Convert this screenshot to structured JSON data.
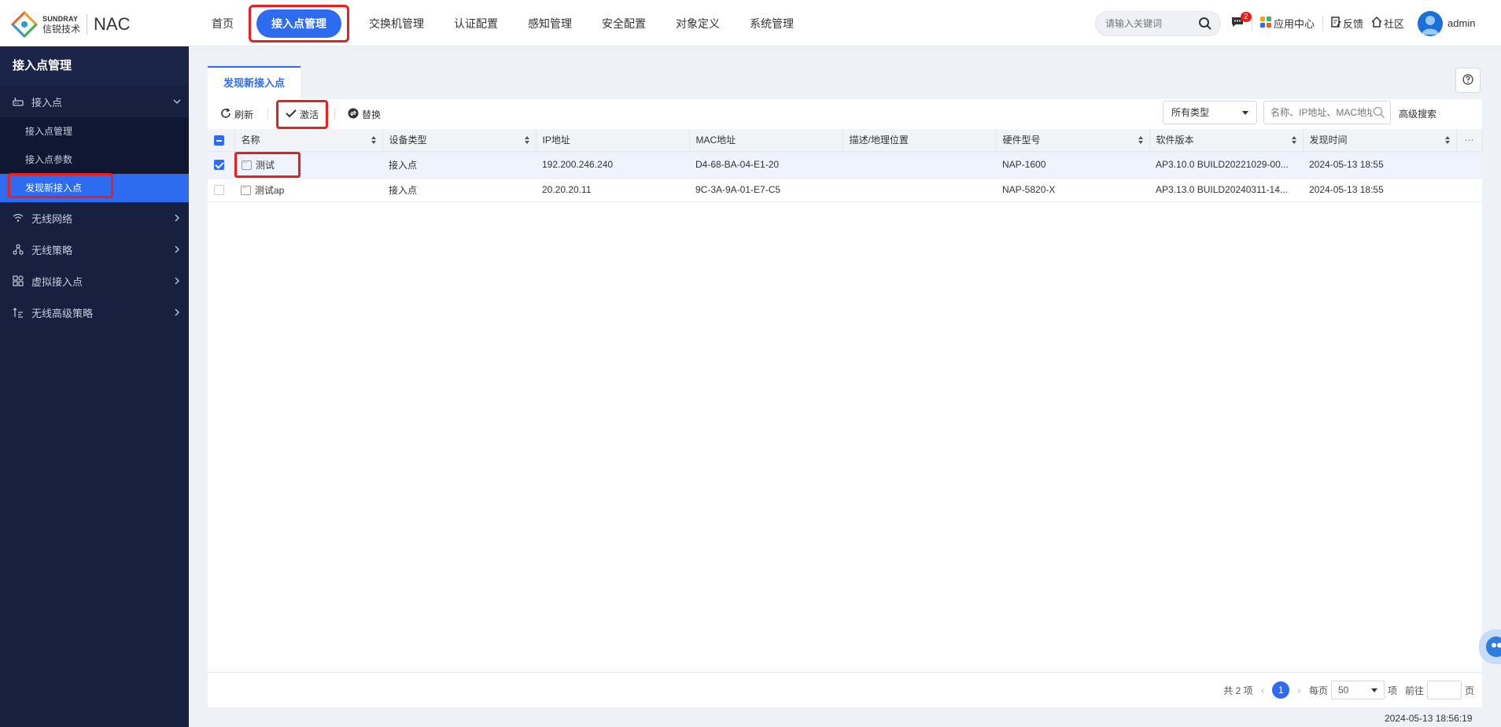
{
  "header": {
    "logo_en": "SUNDRAY",
    "logo_cn": "信锐技术",
    "product": "NAC",
    "nav": [
      "首页",
      "接入点管理",
      "交换机管理",
      "认证配置",
      "感知管理",
      "安全配置",
      "对象定义",
      "系统管理"
    ],
    "search_placeholder": "请输入关键词",
    "msg_badge": "2",
    "app_center": "应用中心",
    "feedback": "反馈",
    "community": "社区",
    "user": "admin"
  },
  "sidebar": {
    "title": "接入点管理",
    "group_ap": "接入点",
    "sub_items": [
      "接入点管理",
      "接入点参数",
      "发现新接入点"
    ],
    "groups": [
      "无线网络",
      "无线策略",
      "虚拟接入点",
      "无线高级策略"
    ]
  },
  "tab": {
    "label": "发现新接入点"
  },
  "toolbar": {
    "refresh": "刷新",
    "activate": "激活",
    "replace": "替换",
    "type_select": "所有类型",
    "search_placeholder": "名称、IP地址、MAC地址",
    "advanced": "高级搜索"
  },
  "table": {
    "columns": [
      "名称",
      "设备类型",
      "IP地址",
      "MAC地址",
      "描述/地理位置",
      "硬件型号",
      "软件版本",
      "发现时间"
    ],
    "rows": [
      {
        "name": "测试",
        "type": "接入点",
        "ip": "192.200.246.240",
        "mac": "D4-68-BA-04-E1-20",
        "desc": "",
        "hw": "NAP-1600",
        "sw": "AP3.10.0 BUILD20221029-00...",
        "time": "2024-05-13 18:55",
        "checked": true
      },
      {
        "name": "测试ap",
        "type": "接入点",
        "ip": "20.20.20.11",
        "mac": "9C-3A-9A-01-E7-C5",
        "desc": "",
        "hw": "NAP-5820-X",
        "sw": "AP3.13.0 BUILD20240311-14...",
        "time": "2024-05-13 18:55",
        "checked": false
      }
    ]
  },
  "pager": {
    "total": "共 2 项",
    "page": "1",
    "per_page_label": "每页",
    "per_page": "50",
    "unit": "项",
    "goto": "前往",
    "page_unit": "页"
  },
  "footer": {
    "time": "2024-05-13 18:56:19"
  }
}
